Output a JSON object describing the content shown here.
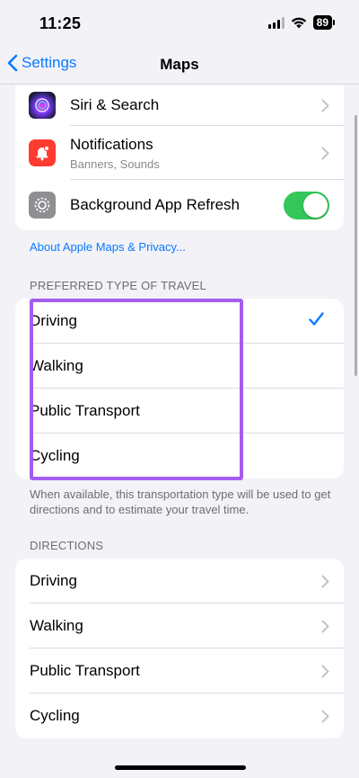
{
  "status_bar": {
    "time": "11:25",
    "battery": "89"
  },
  "nav": {
    "back_label": "Settings",
    "title": "Maps"
  },
  "settings_group": {
    "siri": {
      "label": "Siri & Search"
    },
    "notifications": {
      "label": "Notifications",
      "sublabel": "Banners, Sounds"
    },
    "background_refresh": {
      "label": "Background App Refresh",
      "enabled": true
    }
  },
  "privacy_link": "About Apple Maps & Privacy...",
  "preferred_travel": {
    "header": "PREFERRED TYPE OF TRAVEL",
    "items": [
      "Driving",
      "Walking",
      "Public Transport",
      "Cycling"
    ],
    "selected": "Driving",
    "footnote": "When available, this transportation type will be used to get directions and to estimate your travel time."
  },
  "directions": {
    "header": "DIRECTIONS",
    "items": [
      "Driving",
      "Walking",
      "Public Transport",
      "Cycling"
    ]
  },
  "colors": {
    "accent": "#0a7aff",
    "toggle_on": "#34c759",
    "highlight": "#a45cf0",
    "notifications_icon": "#ff3b30",
    "siri_icon": "#1c1c3a",
    "refresh_icon": "#8e8e93"
  },
  "icons": [
    "siri-icon",
    "notifications-icon",
    "gear-icon",
    "chevron-right-icon",
    "checkmark-icon",
    "chevron-left-icon",
    "wifi-icon",
    "signal-icon",
    "battery-icon"
  ]
}
